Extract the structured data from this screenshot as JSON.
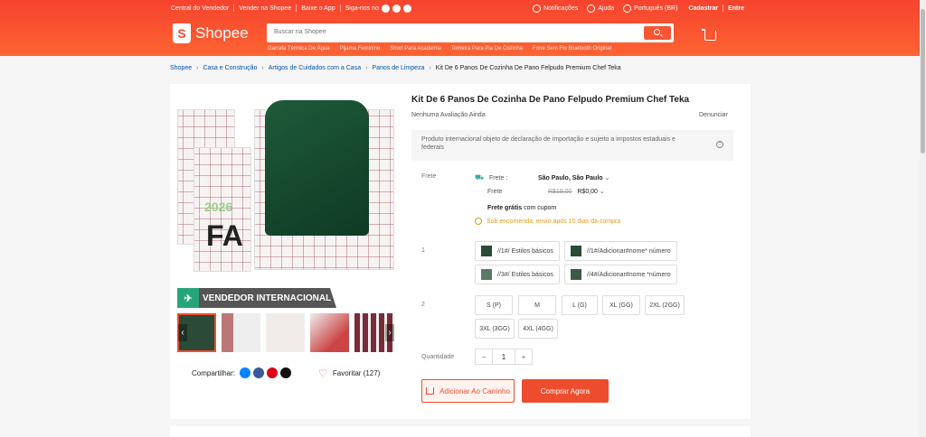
{
  "topbar": {
    "links": [
      "Central do Vendedor",
      "Vender na Shopee",
      "Baixe o App",
      "Siga-nos no"
    ],
    "notifications": "Notificações",
    "help": "Ajuda",
    "language": "Português (BR)",
    "signup": "Cadastrar",
    "login": "Entre"
  },
  "brand": {
    "logo_letter": "S",
    "name": "Shopee",
    "color": "#ee4d2d"
  },
  "search": {
    "placeholder": "Buscar na Shopee",
    "suggestions": [
      "Garrafa Térmica De Água",
      "Pijama Feminino",
      "Short Para Academia",
      "Tomeira Para Pia De Cozinha",
      "Fone Sem Fio Bluetooth Original"
    ]
  },
  "breadcrumb": [
    "Shopee",
    "Casa e Construção",
    "Artigos de Cuidados com a Casa",
    "Panos de Limpeza",
    "Kit De 6 Panos De Cozinha De Pano Felpudo Premium Chef Teka"
  ],
  "gallery": {
    "year_text": "2026",
    "fa_text": "FA",
    "badge": "VENDEDOR INTERNACIONAL",
    "prev_icon": "chevron-left-icon",
    "next_icon": "chevron-right-icon"
  },
  "share": {
    "label": "Compartilhar:",
    "icons": [
      "messenger-icon",
      "facebook-icon",
      "pinterest-icon",
      "x-icon"
    ]
  },
  "favorite": {
    "label": "Favoritar (127)"
  },
  "product": {
    "title": "Kit De 6 Panos De Cozinha De Pano Felpudo Premium Chef Teka",
    "rating": "Nenhuma Avaliação Ainda",
    "report": "Denunciar",
    "notice": "Produto internacional objeto de declaração de importação e sujeito a impostos estaduais e federais"
  },
  "shipping": {
    "label": "Frete",
    "to_label": "Frete :",
    "destination": "São Paulo, São Paulo",
    "cost_label": "Frete",
    "old_price": "R$19,00",
    "new_price": "R$0,00",
    "free_bold": "Frete grátis",
    "free_rest": "com cupom",
    "on_demand": "Sob encomenda: envio após 10 dias da compra"
  },
  "variation1": {
    "label": "1",
    "options": [
      "//1#/ Estilos básicos",
      "//1#/Adicionar#nome* número",
      "//3#/ Estilos básicos",
      "//4#/Adicionar#nome *número"
    ]
  },
  "variation2": {
    "label": "2",
    "options": [
      "S (P)",
      "M",
      "L (G)",
      "XL (GG)",
      "2XL (2GG)",
      "3XL (3GG)",
      "4XL (4GG)"
    ]
  },
  "quantity": {
    "label": "Quantidade",
    "minus": "−",
    "value": "1",
    "plus": "+"
  },
  "actions": {
    "add_to_cart": "Adicionar Ao Carrinho",
    "buy_now": "Comprar Agora"
  }
}
